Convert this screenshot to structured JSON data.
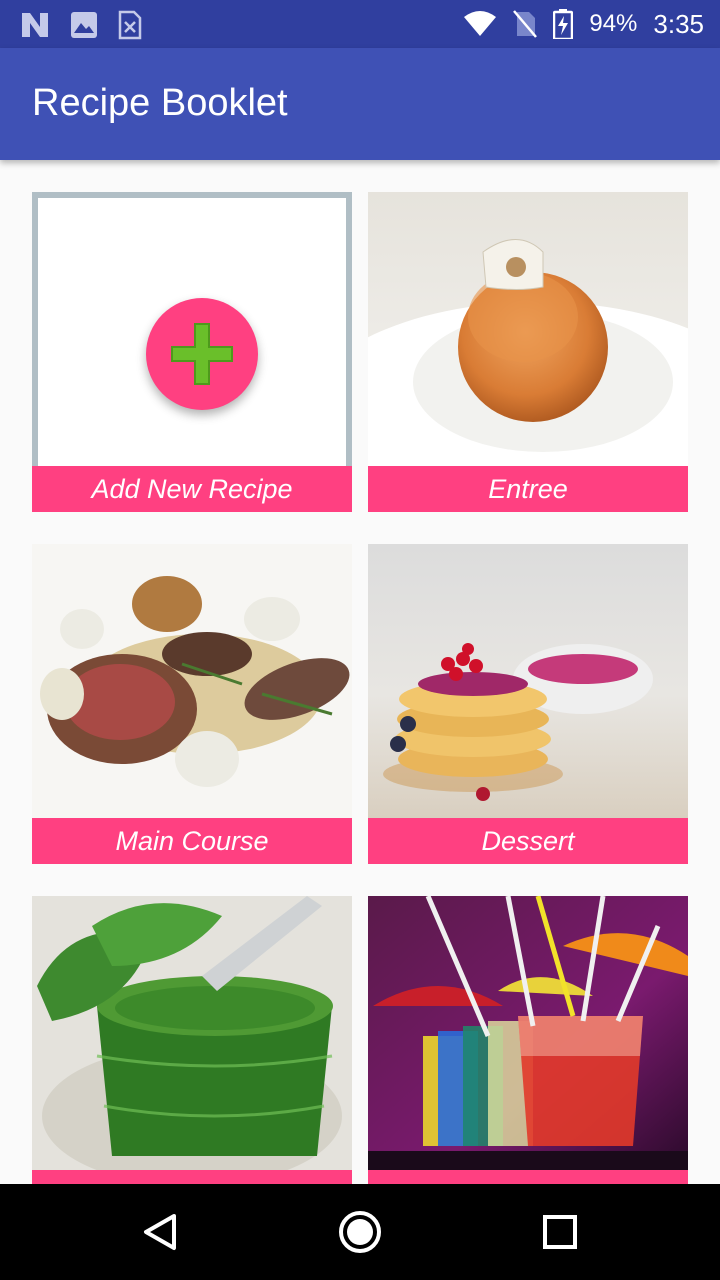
{
  "status_bar": {
    "battery_percent": "94%",
    "time": "3:35",
    "icons": [
      "n-notification-icon",
      "image-notification-icon",
      "document-notification-icon",
      "wifi-icon",
      "no-sim-icon",
      "battery-charging-icon"
    ]
  },
  "app_bar": {
    "title": "Recipe Booklet"
  },
  "grid": {
    "add_card": {
      "label": "Add New Recipe",
      "icon": "plus-icon"
    },
    "categories": [
      {
        "label": "Entree",
        "image": "entree-food-photo"
      },
      {
        "label": "Main Course",
        "image": "main-course-food-photo"
      },
      {
        "label": "Dessert",
        "image": "dessert-food-photo"
      },
      {
        "label": "",
        "image": "pesto-sauce-photo"
      },
      {
        "label": "",
        "image": "cocktail-drinks-photo"
      }
    ]
  },
  "nav_bar": {
    "buttons": [
      "back-icon",
      "home-icon",
      "recents-icon"
    ]
  },
  "colors": {
    "status_bar": "#303f9f",
    "app_bar": "#3f51b5",
    "accent": "#ff4081",
    "card_border": "#b0bec5",
    "plus": "#6abf2a"
  }
}
